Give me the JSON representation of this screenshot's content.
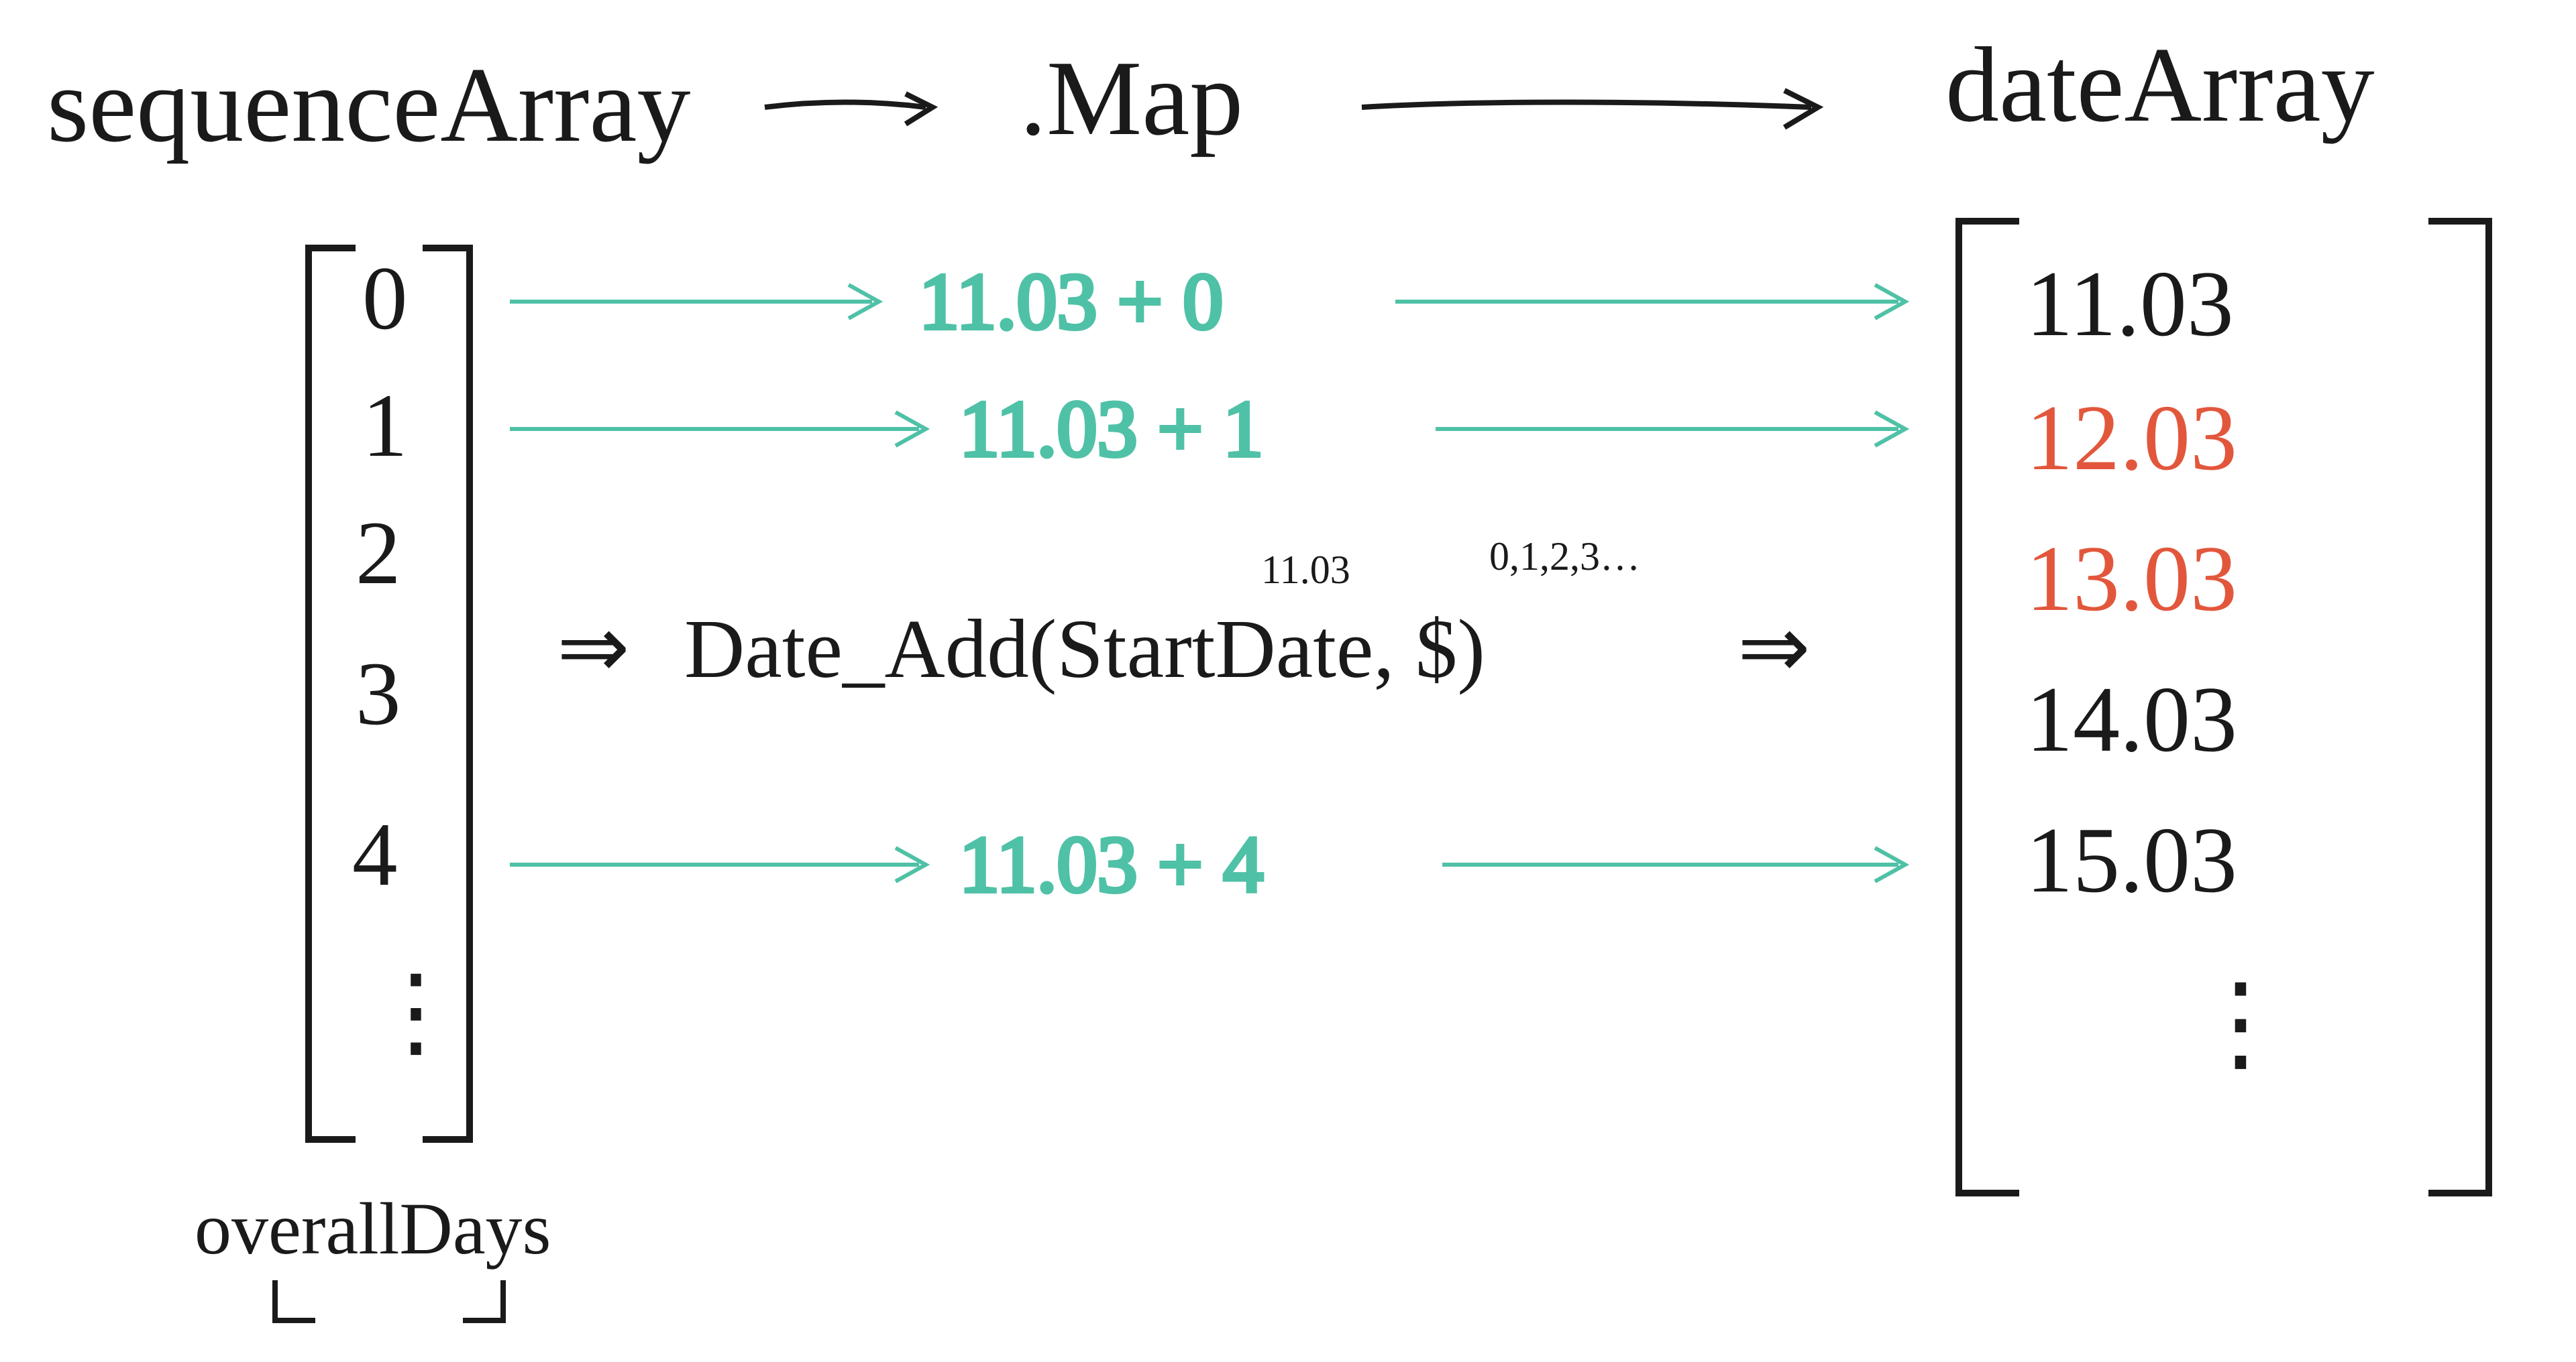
{
  "header": {
    "left_label": "sequenceArray",
    "middle_label": ".Map",
    "right_label": "dateArray"
  },
  "sequence": {
    "items": [
      "0",
      "1",
      "2",
      "3",
      "4",
      "⋮"
    ],
    "bottom_label": "overallDays"
  },
  "map_rows": [
    {
      "expr": "11.03 + 0"
    },
    {
      "expr": "11.03 + 1"
    },
    {
      "expr": "11.03 + 4"
    }
  ],
  "formula": {
    "prefix": "⇒",
    "text": "Date_Add(StartDate, $)",
    "suffix": "⇒",
    "note_start": "11.03",
    "note_dollar": "0,1,2,3…"
  },
  "dates": {
    "items": [
      {
        "t": "11.03",
        "c": "black"
      },
      {
        "t": "12.03",
        "c": "red"
      },
      {
        "t": "13.03",
        "c": "red"
      },
      {
        "t": "14.03",
        "c": "black"
      },
      {
        "t": "15.03",
        "c": "black"
      },
      {
        "t": "⋮",
        "c": "black"
      }
    ]
  },
  "chart_data": {
    "type": "table",
    "description": "Mapping a sequence of day offsets through Date_Add(StartDate,$) to produce a date array",
    "start_date": "11.03",
    "sequence": [
      0,
      1,
      2,
      3,
      4
    ],
    "function": "Date_Add(StartDate, $)",
    "output": [
      "11.03",
      "12.03",
      "13.03",
      "14.03",
      "15.03"
    ],
    "highlighted_output": [
      "12.03",
      "13.03"
    ]
  }
}
